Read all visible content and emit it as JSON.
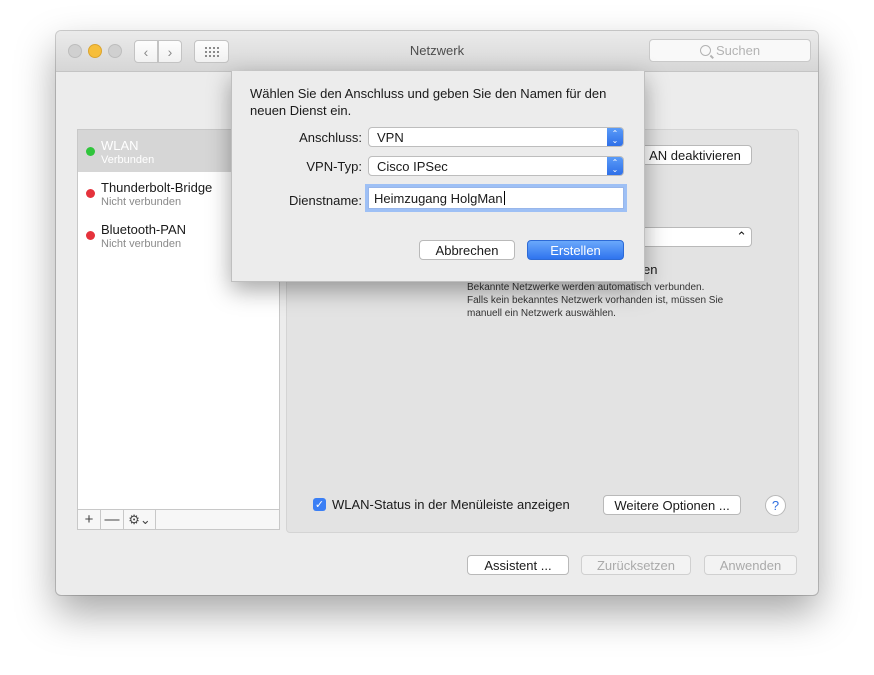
{
  "window": {
    "title": "Netzwerk",
    "search_placeholder": "Suchen"
  },
  "networks": [
    {
      "name": "WLAN",
      "status": "Verbunden",
      "color": "#30c53c",
      "selected": true
    },
    {
      "name": "Thunderbolt-Bridge",
      "status": "Nicht verbunden",
      "color": "#e5323c",
      "selected": false
    },
    {
      "name": "Bluetooth-PAN",
      "status": "Nicht verbunden",
      "color": "#e5323c",
      "selected": false
    }
  ],
  "list_toolbar": {
    "add": "+",
    "remove": "—",
    "gear": "⚙⌄"
  },
  "pane": {
    "wlan_button_fragment": "AN deaktivieren",
    "hidden_text_fragment": "en",
    "info_lines": [
      "Bekannte Netzwerke werden automatisch verbunden.",
      "Falls kein bekanntes Netzwerk vorhanden ist, müssen Sie",
      "manuell ein Netzwerk auswählen."
    ],
    "wlan_status_label": "WLAN-Status in der Menüleiste anzeigen",
    "wlan_status_checked": true,
    "more_options": "Weitere Optionen ...",
    "help": "?"
  },
  "footer": {
    "assistant": "Assistent ...",
    "reset": "Zurücksetzen",
    "apply": "Anwenden"
  },
  "sheet": {
    "message": "Wählen Sie den Anschluss und geben Sie den Namen für den neuen Dienst ein.",
    "interface_label": "Anschluss:",
    "interface_value": "VPN",
    "vpn_type_label": "VPN-Typ:",
    "vpn_type_value": "Cisco IPSec",
    "service_name_label": "Dienstname:",
    "service_name_value": "Heimzugang HolgMan",
    "cancel": "Abbrechen",
    "create": "Erstellen"
  },
  "colors": {
    "accent": "#2f74ee",
    "connected": "#30c53c",
    "disconnected": "#e5323c"
  }
}
